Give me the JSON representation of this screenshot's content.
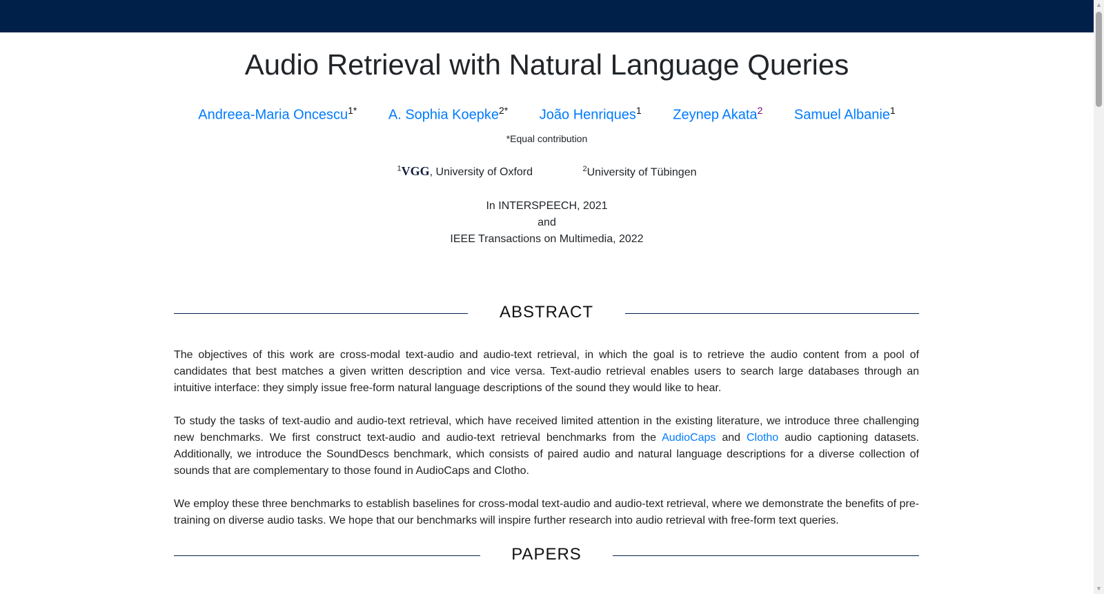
{
  "title": "Audio Retrieval with Natural Language Queries",
  "authors": [
    {
      "name": "Andreea-Maria Oncescu",
      "sup": "1*"
    },
    {
      "name": "A. Sophia Koepke",
      "sup": "2*"
    },
    {
      "name": "João Henriques",
      "sup": "1"
    },
    {
      "name": "Zeynep Akata",
      "sup": "2"
    },
    {
      "name": "Samuel Albanie",
      "sup": "1"
    }
  ],
  "equal_contribution": "*Equal contribution",
  "affiliations": {
    "a1_sup": "1",
    "a1_logo_text": "VGG",
    "a1_text": ", University of Oxford",
    "a2_sup": "2",
    "a2_text": "University of Tübingen"
  },
  "venue": {
    "line1": "In INTERSPEECH, 2021",
    "line2": "and",
    "line3": "IEEE Transactions on Multimedia, 2022"
  },
  "sections": {
    "abstract": "ABSTRACT",
    "papers": "PAPERS"
  },
  "abstract": {
    "p1": "The objectives of this work are cross-modal text-audio and audio-text retrieval, in which the goal is to retrieve the audio content from a pool of candidates that best matches a given written description and vice versa. Text-audio retrieval enables users to search large databases through an intuitive interface: they simply issue free-form natural language descriptions of the sound they would like to hear.",
    "p2_a": "To study the tasks of text-audio and audio-text retrieval, which have received limited attention in the existing literature, we introduce three challenging new benchmarks. We first construct text-audio and audio-text retrieval benchmarks from the ",
    "p2_link1": "AudioCaps",
    "p2_b": " and ",
    "p2_link2": "Clotho",
    "p2_c": " audio captioning datasets. Additionally, we introduce the SoundDescs benchmark, which consists of paired audio and natural language descriptions for a diverse collection of sounds that are complementary to those found in AudioCaps and Clotho.",
    "p3": "We employ these three benchmarks to establish baselines for cross-modal text-audio and audio-text retrieval, where we demonstrate the benefits of pre-training on diverse audio tasks. We hope that our benchmarks will inspire further research into audio retrieval with free-form text queries."
  },
  "colors": {
    "navbar": "#00204a",
    "link": "#007bff",
    "purple_sup": "#800080"
  }
}
